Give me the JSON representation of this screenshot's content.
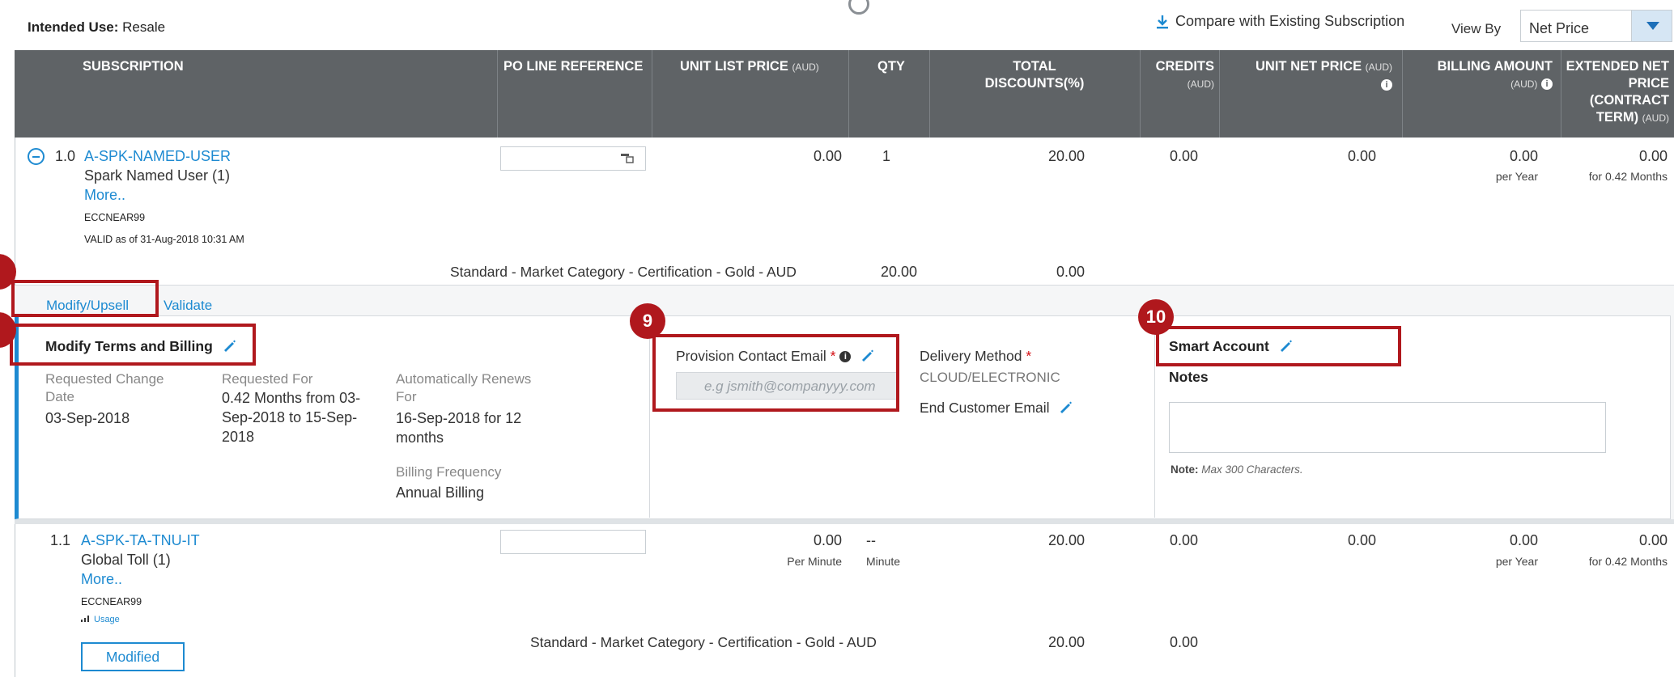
{
  "top": {
    "intended_label": "Intended Use:",
    "intended_value": "Resale",
    "compare_label": "Compare with Existing Subscription",
    "viewby_label": "View By",
    "viewby_value": "Net Price"
  },
  "table_headers": {
    "subscription": "SUBSCRIPTION",
    "po_line": "PO LINE REFERENCE",
    "unit_list_price": "UNIT LIST PRICE",
    "unit_list_price_unit": "(AUD)",
    "qty": "QTY",
    "total_discounts_1": "TOTAL",
    "total_discounts_2": "DISCOUNTS(%)",
    "credits": "CREDITS",
    "credits_unit": "(AUD)",
    "unit_net_price": "UNIT NET PRICE",
    "unit_net_price_unit": "(AUD)",
    "billing_amount": "BILLING AMOUNT",
    "billing_amount_unit": "(AUD)",
    "ext_net_1": "EXTENDED NET",
    "ext_net_2": "PRICE",
    "ext_net_3": "(CONTRACT",
    "ext_net_4": "TERM)",
    "ext_net_unit": "(AUD)"
  },
  "row1": {
    "line_no": "1.0",
    "sku": "A-SPK-NAMED-USER",
    "desc": "Spark Named User (1)",
    "more": "More..",
    "code": "ECCNEAR99",
    "valid": "VALID as of 31-Aug-2018 10:31 AM",
    "unit_list_price": "0.00",
    "qty": "1",
    "total_discounts": "20.00",
    "credits": "0.00",
    "unit_net_price": "0.00",
    "billing_amount": "0.00",
    "billing_period": "per Year",
    "ext_net": "0.00",
    "ext_term": "for 0.42 Months",
    "discount_desc": "Standard - Market Category - Certification - Gold - AUD",
    "discount_pct": "20.00",
    "discount_amt": "0.00"
  },
  "panel": {
    "tab_modify": "Modify/Upsell",
    "tab_validate": "Validate",
    "terms_heading": "Modify Terms and Billing",
    "req_change_label_1": "Requested Change",
    "req_change_label_2": "Date",
    "req_change_value": "03-Sep-2018",
    "req_for_label": "Requested For",
    "req_for_line1": "0.42 Months from 03-",
    "req_for_line2": "Sep-2018 to 15-Sep-",
    "req_for_line3": "2018",
    "auto_renew_label_1": "Automatically Renews",
    "auto_renew_label_2": "For",
    "auto_renew_line1": "16-Sep-2018 for 12",
    "auto_renew_line2": "months",
    "billing_freq_label": "Billing Frequency",
    "billing_freq_value": "Annual Billing",
    "provision_label": "Provision Contact Email",
    "email_placeholder": "e.g jsmith@companyyy.com",
    "delivery_label": "Delivery Method",
    "delivery_value": "CLOUD/ELECTRONIC",
    "end_customer_label": "End Customer Email",
    "smart_account_label": "Smart Account",
    "notes_label": "Notes",
    "note_prefix": "Note:",
    "note_text": "Max 300 Characters."
  },
  "callouts": {
    "badge_9": "9",
    "badge_10": "10"
  },
  "row2": {
    "line_no": "1.1",
    "sku": "A-SPK-TA-TNU-IT",
    "desc": "Global Toll (1)",
    "more": "More..",
    "code": "ECCNEAR99",
    "usage": "Usage",
    "unit_list_price": "0.00",
    "unit_list_period": "Per Minute",
    "qty": "--",
    "qty_unit": "Minute",
    "total_discounts": "20.00",
    "credits": "0.00",
    "unit_net_price": "0.00",
    "billing_amount": "0.00",
    "billing_period": "per Year",
    "ext_net": "0.00",
    "ext_term": "for 0.42 Months",
    "discount_desc": "Standard - Market Category - Certification - Gold - AUD",
    "discount_pct": "20.00",
    "discount_amt": "0.00",
    "modified_btn": "Modified"
  },
  "colors": {
    "accent": "#1d8ad1",
    "header_bg": "#5f6366",
    "callout": "#b0181d"
  }
}
